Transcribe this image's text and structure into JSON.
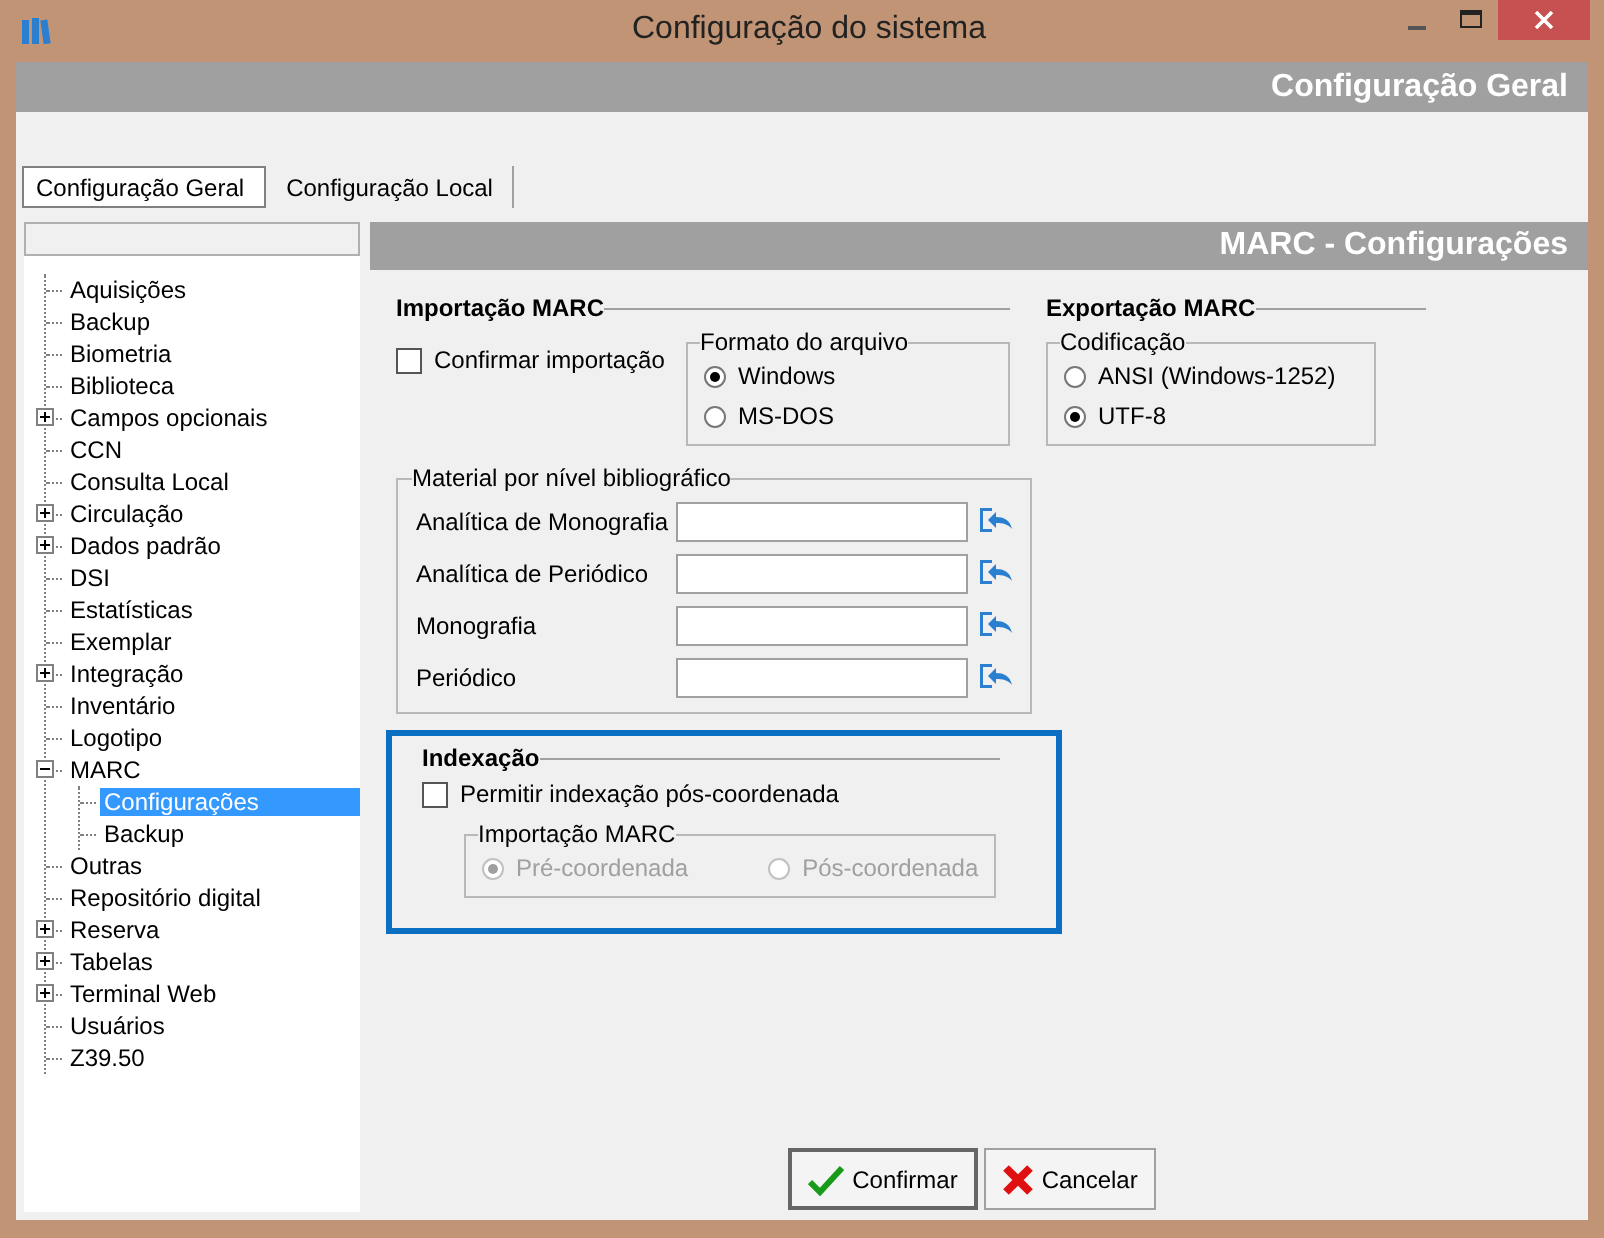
{
  "window": {
    "title": "Configuração do sistema"
  },
  "header_title": "Configuração Geral",
  "tabs": [
    {
      "label": "Configuração Geral",
      "selected": true
    },
    {
      "label": "Configuração Local",
      "selected": false
    }
  ],
  "tree": [
    {
      "label": "Aquisições"
    },
    {
      "label": "Backup"
    },
    {
      "label": "Biometria"
    },
    {
      "label": "Biblioteca"
    },
    {
      "label": "Campos opcionais",
      "expanded": false
    },
    {
      "label": "CCN"
    },
    {
      "label": "Consulta Local"
    },
    {
      "label": "Circulação",
      "expanded": false
    },
    {
      "label": "Dados padrão",
      "expanded": false
    },
    {
      "label": "DSI"
    },
    {
      "label": "Estatísticas"
    },
    {
      "label": "Exemplar"
    },
    {
      "label": "Integração",
      "expanded": false
    },
    {
      "label": "Inventário"
    },
    {
      "label": "Logotipo"
    },
    {
      "label": "MARC",
      "expanded": true,
      "children": [
        {
          "label": "Configurações",
          "selected": true
        },
        {
          "label": "Backup",
          "selected": false
        }
      ]
    },
    {
      "label": "Outras"
    },
    {
      "label": "Repositório digital"
    },
    {
      "label": "Reserva",
      "expanded": false
    },
    {
      "label": "Tabelas",
      "expanded": false
    },
    {
      "label": "Terminal Web",
      "expanded": false
    },
    {
      "label": "Usuários"
    },
    {
      "label": "Z39.50"
    }
  ],
  "panel_title": "MARC - Configurações",
  "import_marc": {
    "title": "Importação MARC",
    "confirm": {
      "label": "Confirmar importação",
      "checked": false
    },
    "file_format": {
      "title": "Formato do arquivo",
      "options": [
        {
          "label": "Windows",
          "selected": true
        },
        {
          "label": "MS-DOS",
          "selected": false
        }
      ]
    }
  },
  "export_marc": {
    "title": "Exportação MARC",
    "encoding": {
      "title": "Codificação",
      "options": [
        {
          "label": "ANSI (Windows-1252)",
          "selected": false
        },
        {
          "label": "UTF-8",
          "selected": true
        }
      ]
    }
  },
  "material": {
    "title": "Material por nível bibliográfico",
    "rows": [
      {
        "label": "Analítica de Monografia"
      },
      {
        "label": "Analítica de Periódico"
      },
      {
        "label": "Monografia"
      },
      {
        "label": "Periódico"
      }
    ]
  },
  "indexing": {
    "title": "Indexação",
    "highlighted": true,
    "allow": {
      "label": "Permitir indexação pós-coordenada",
      "checked": false
    },
    "import_marc": {
      "title": "Importação MARC",
      "disabled": true,
      "options": [
        {
          "label": "Pré-coordenada",
          "selected": true
        },
        {
          "label": "Pós-coordenada",
          "selected": false
        }
      ]
    }
  },
  "buttons": [
    {
      "label": "Confirmar",
      "kind": "confirm"
    },
    {
      "label": "Cancelar",
      "kind": "cancel"
    }
  ]
}
